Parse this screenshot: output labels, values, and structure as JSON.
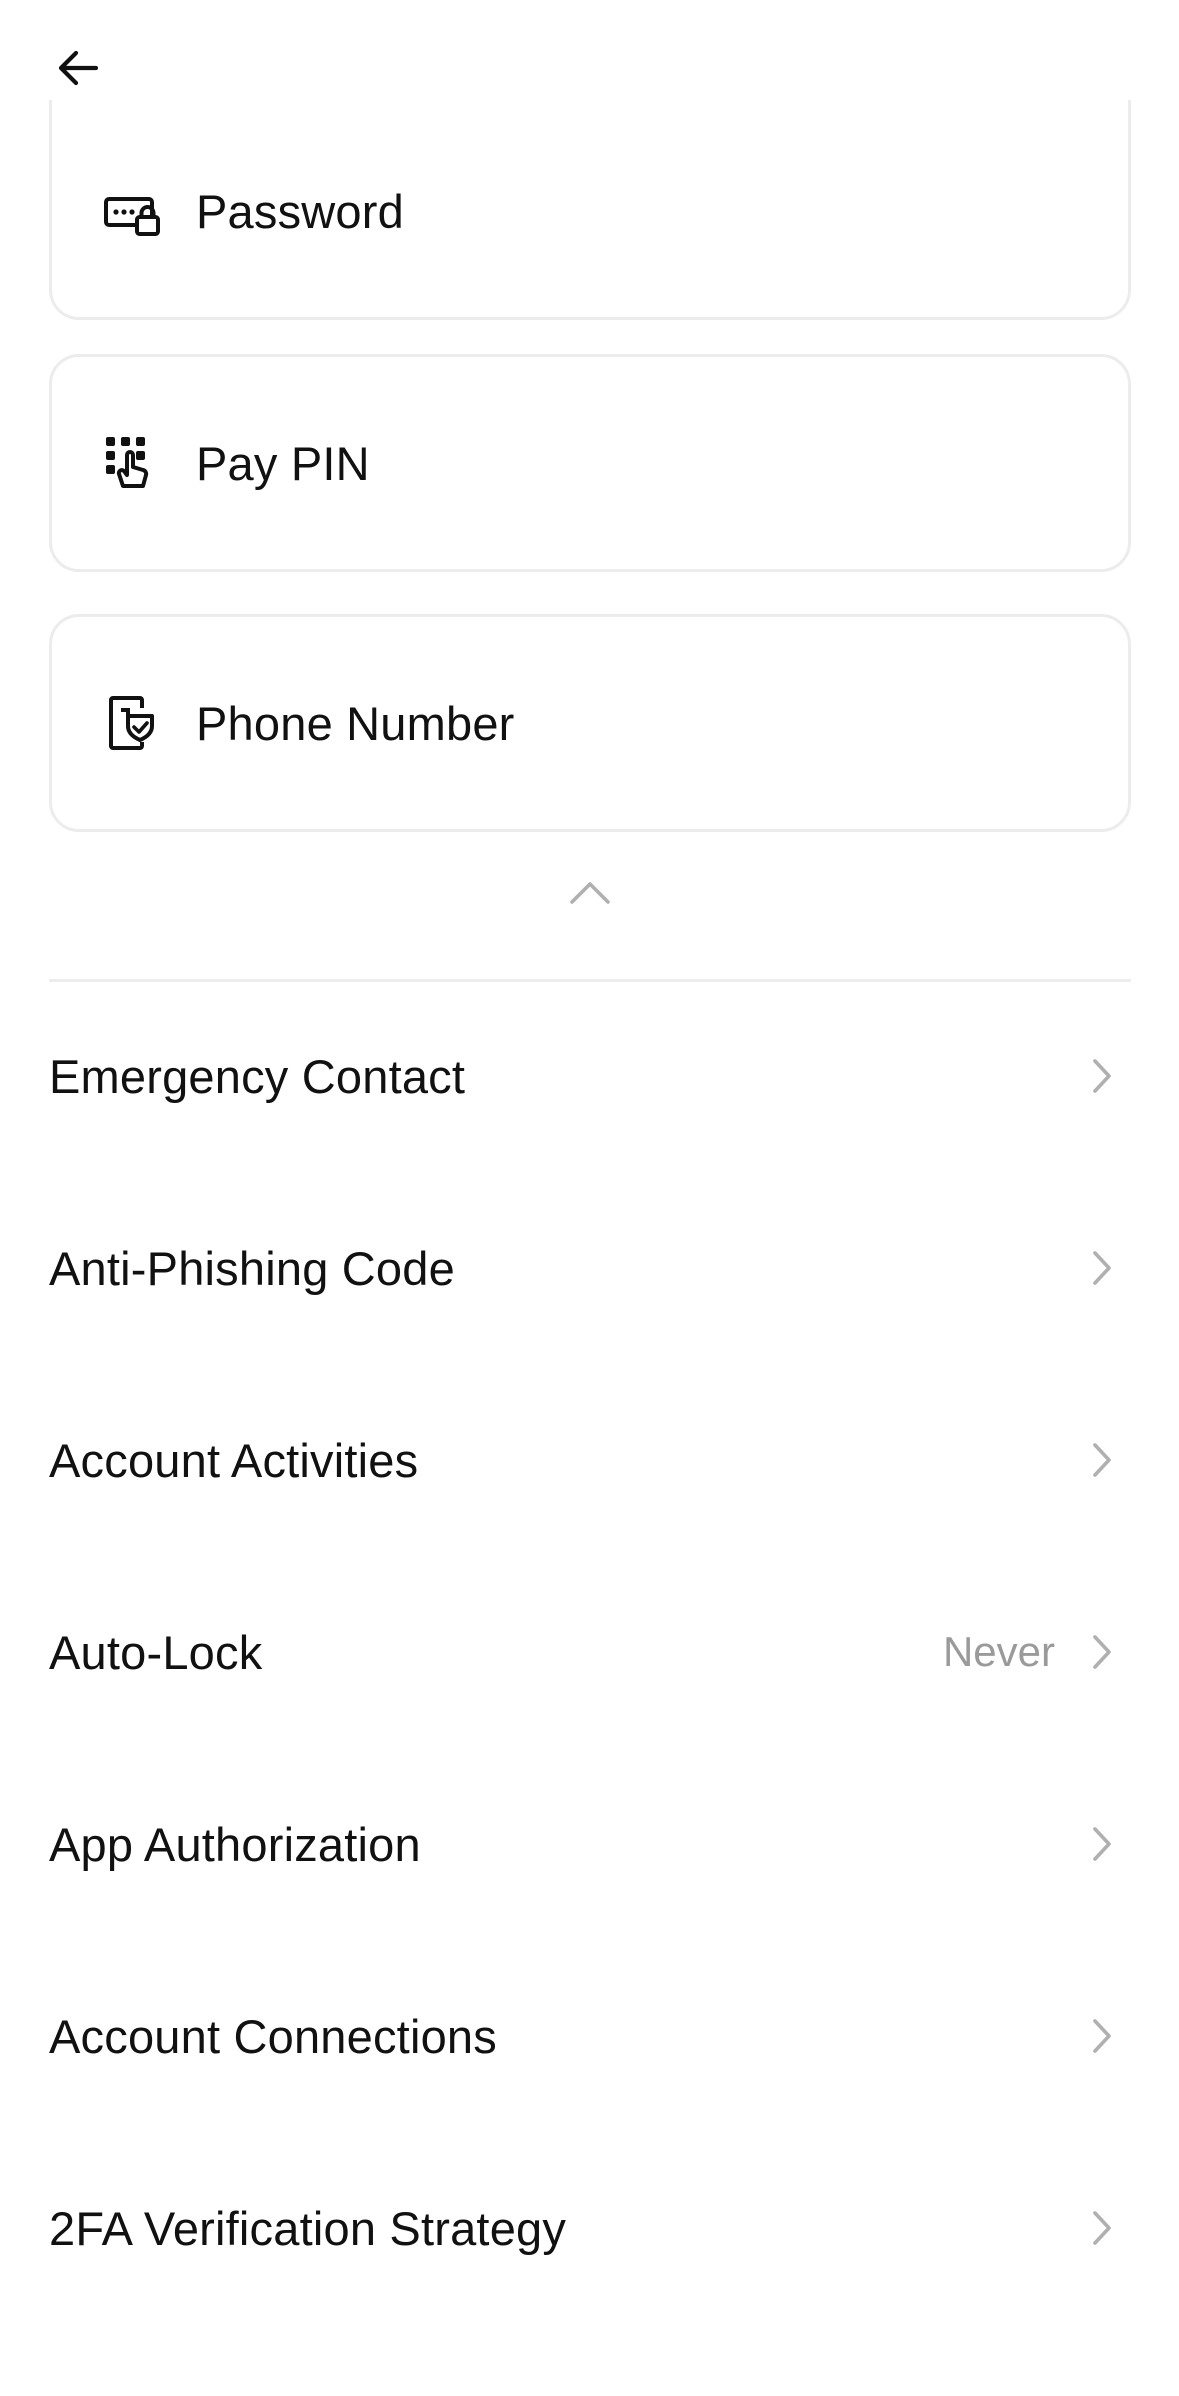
{
  "cards": [
    {
      "label": "Password",
      "icon": "password-lock-icon"
    },
    {
      "label": "Pay PIN",
      "icon": "keypad-touch-icon"
    },
    {
      "label": "Phone Number",
      "icon": "phone-verify-icon"
    }
  ],
  "menu": {
    "items": [
      {
        "label": "Emergency Contact",
        "value": ""
      },
      {
        "label": "Anti-Phishing Code",
        "value": ""
      },
      {
        "label": "Account Activities",
        "value": ""
      },
      {
        "label": "Auto-Lock",
        "value": "Never"
      },
      {
        "label": "App Authorization",
        "value": ""
      },
      {
        "label": "Account Connections",
        "value": ""
      },
      {
        "label": "2FA Verification Strategy",
        "value": ""
      }
    ]
  },
  "colors": {
    "text": "#111111",
    "secondary_text": "#9a9a9a",
    "border": "#ececec",
    "chevron": "#b0b0b0"
  }
}
